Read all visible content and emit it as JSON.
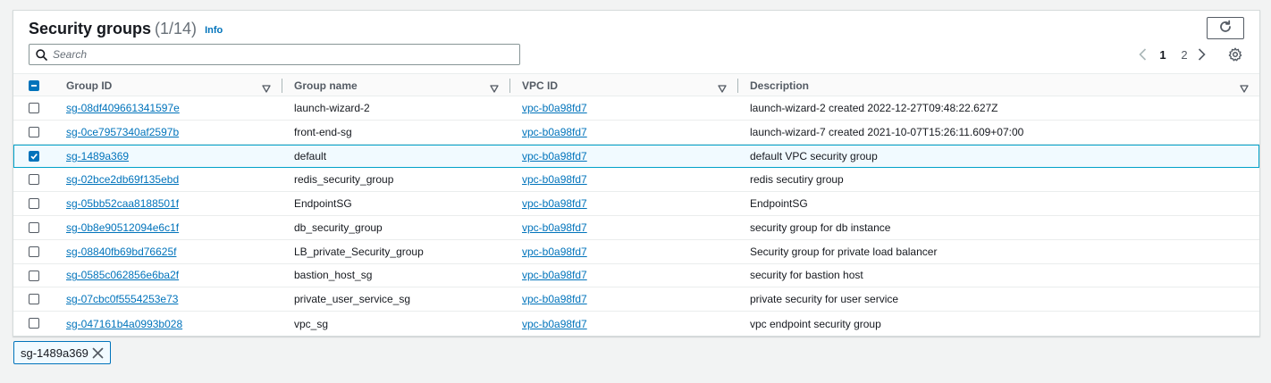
{
  "header": {
    "title": "Security groups",
    "count": "(1/14)",
    "info_label": "Info"
  },
  "search": {
    "placeholder": "Search",
    "value": ""
  },
  "pagination": {
    "pages": [
      "1",
      "2"
    ],
    "current": "1"
  },
  "table": {
    "columns": [
      "Group ID",
      "Group name",
      "VPC ID",
      "Description"
    ],
    "header_checkbox_state": "indeterminate",
    "rows": [
      {
        "group_id": "sg-08df409661341597e",
        "group_name": "launch-wizard-2",
        "vpc_id": "vpc-b0a98fd7",
        "description": "launch-wizard-2 created 2022-12-27T09:48:22.627Z",
        "selected": false
      },
      {
        "group_id": "sg-0ce7957340af2597b",
        "group_name": "front-end-sg",
        "vpc_id": "vpc-b0a98fd7",
        "description": "launch-wizard-7 created 2021-10-07T15:26:11.609+07:00",
        "selected": false
      },
      {
        "group_id": "sg-1489a369",
        "group_name": "default",
        "vpc_id": "vpc-b0a98fd7",
        "description": "default VPC security group",
        "selected": true
      },
      {
        "group_id": "sg-02bce2db69f135ebd",
        "group_name": "redis_security_group",
        "vpc_id": "vpc-b0a98fd7",
        "description": "redis secutiry group",
        "selected": false
      },
      {
        "group_id": "sg-05bb52caa8188501f",
        "group_name": "EndpointSG",
        "vpc_id": "vpc-b0a98fd7",
        "description": "EndpointSG",
        "selected": false
      },
      {
        "group_id": "sg-0b8e90512094e6c1f",
        "group_name": "db_security_group",
        "vpc_id": "vpc-b0a98fd7",
        "description": "security group for db instance",
        "selected": false
      },
      {
        "group_id": "sg-08840fb69bd76625f",
        "group_name": "LB_private_Security_group",
        "vpc_id": "vpc-b0a98fd7",
        "description": "Security group for private load balancer",
        "selected": false
      },
      {
        "group_id": "sg-0585c062856e6ba2f",
        "group_name": "bastion_host_sg",
        "vpc_id": "vpc-b0a98fd7",
        "description": "security for bastion host",
        "selected": false
      },
      {
        "group_id": "sg-07cbc0f5554253e73",
        "group_name": "private_user_service_sg",
        "vpc_id": "vpc-b0a98fd7",
        "description": "private security for user service",
        "selected": false
      },
      {
        "group_id": "sg-047161b4a0993b028",
        "group_name": "vpc_sg",
        "vpc_id": "vpc-b0a98fd7",
        "description": "vpc endpoint security group",
        "selected": false
      }
    ]
  },
  "selection_token": {
    "label": "sg-1489a369"
  },
  "icons": {
    "refresh": "refresh-icon",
    "search": "search-icon",
    "prev": "chevron-left-icon",
    "next": "chevron-right-icon",
    "settings": "gear-icon",
    "sort": "sort-caret-icon",
    "dismiss": "close-icon"
  },
  "colors": {
    "link": "#0073bb",
    "selected_border": "#00a1c9",
    "selected_bg": "#f1faff"
  }
}
